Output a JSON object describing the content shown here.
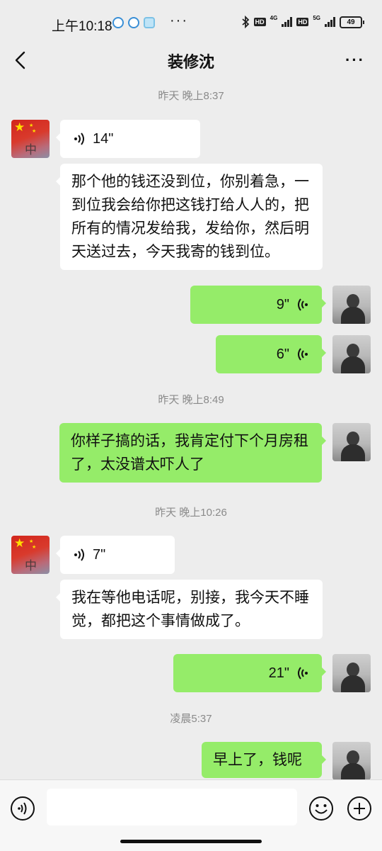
{
  "status_bar": {
    "time": "上午10:18",
    "dots": "···",
    "net_left": "4G",
    "net_right": "5G",
    "hd": "HD",
    "battery": "49"
  },
  "header": {
    "title": "装修沈",
    "more": "···"
  },
  "chat": {
    "ts1": "昨天 晚上8:37",
    "m1_voice": "14\"",
    "m2_text": "那个他的钱还没到位，你别着急，一到位我会给你把这钱打给人人的，把所有的情况发给我，发给你，然后明天送过去，今天我寄的钱到位。",
    "m3_voice": "9\"",
    "m4_voice": "6\"",
    "ts2": "昨天 晚上8:49",
    "m5_text": "你样子搞的话，我肯定付下个月房租了，太没谱太吓人了",
    "ts3": "昨天 晚上10:26",
    "m6_voice": "7\"",
    "m7_text": "我在等他电话呢，别接，我今天不睡觉，都把这个事情做成了。",
    "m8_voice": "21\"",
    "ts4": "凌晨5:37",
    "m9_text": "早上了，钱呢",
    "avatar_glyph": "中"
  },
  "input": {
    "value": ""
  },
  "colors": {
    "me_bubble": "#95ec69",
    "other_bubble": "#ffffff",
    "background": "#ededed"
  }
}
